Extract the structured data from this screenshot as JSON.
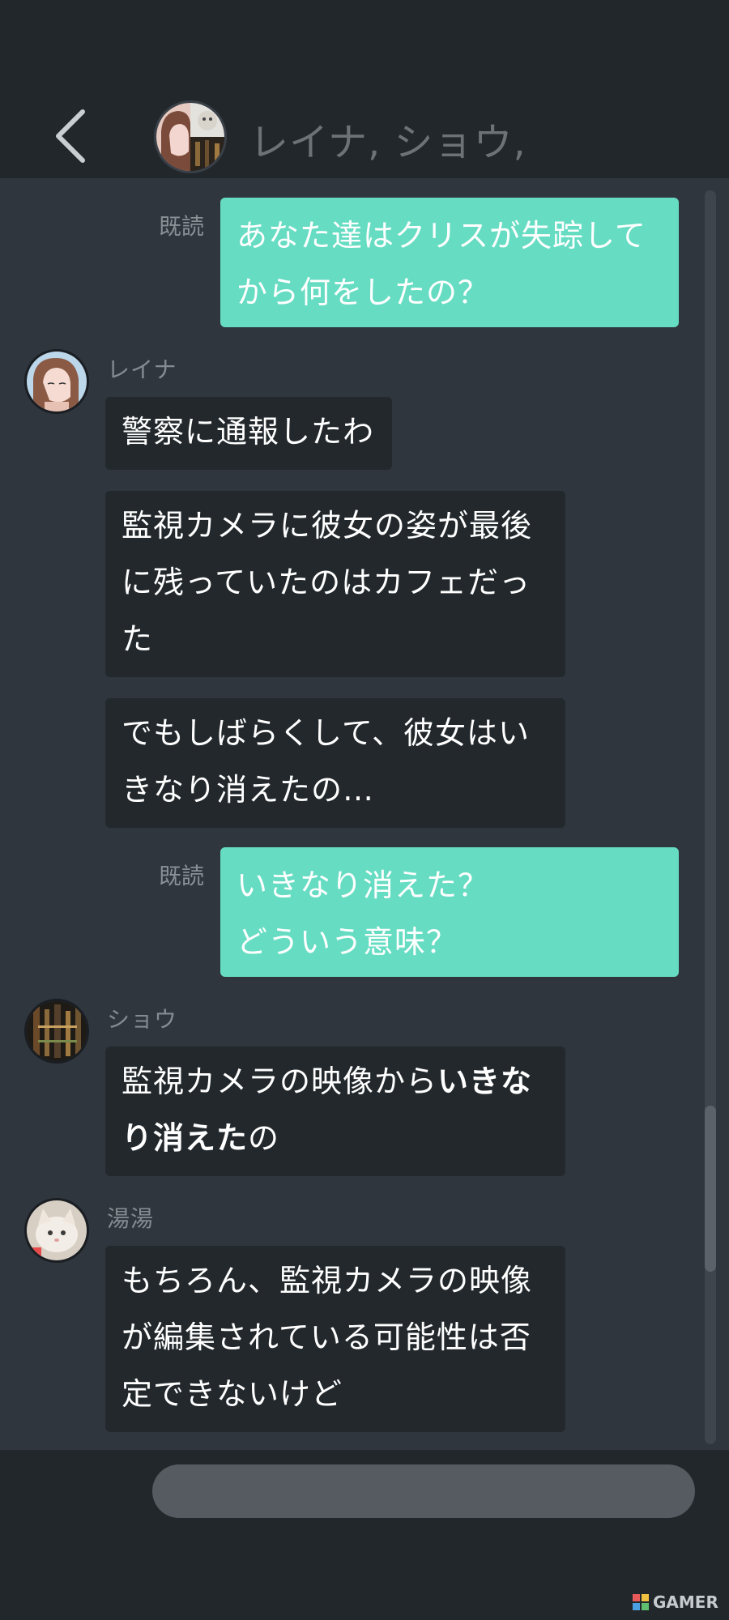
{
  "header": {
    "title": "レイナ, ショウ,",
    "back_icon": "chevron-left-icon"
  },
  "messages": [
    {
      "type": "out",
      "read_label": "既読",
      "lines": [
        "あなた達はクリスが失踪して",
        "から何をしたの？"
      ]
    },
    {
      "type": "in",
      "sender": "レイナ",
      "bubbles": [
        [
          "警察に通報したわ"
        ],
        [
          "監視カメラに彼女の姿が最後",
          "に残っていたのはカフェだっ",
          "た"
        ],
        [
          "でもしばらくして、彼女はい",
          "きなり消えたの…"
        ]
      ]
    },
    {
      "type": "out",
      "read_label": "既読",
      "lines": [
        "いきなり消えた？",
        "どういう意味？"
      ]
    },
    {
      "type": "in",
      "sender": "ショウ",
      "line1_normal": "監視カメラの映像から",
      "line1_bold": "いきな",
      "line2_bold": "り消えた",
      "line2_normal": "の"
    },
    {
      "type": "in",
      "sender": "湯湯",
      "lines": [
        "もちろん、監視カメラの映像",
        "が編集されている可能性は否",
        "定できないけど"
      ]
    }
  ],
  "input": {
    "placeholder": ""
  },
  "watermark": {
    "text": "GAMER"
  },
  "colors": {
    "background": "#22272b",
    "chat_bg": "#30363e",
    "outgoing_bubble": "#66dcc2",
    "incoming_bubble": "#22282c"
  }
}
